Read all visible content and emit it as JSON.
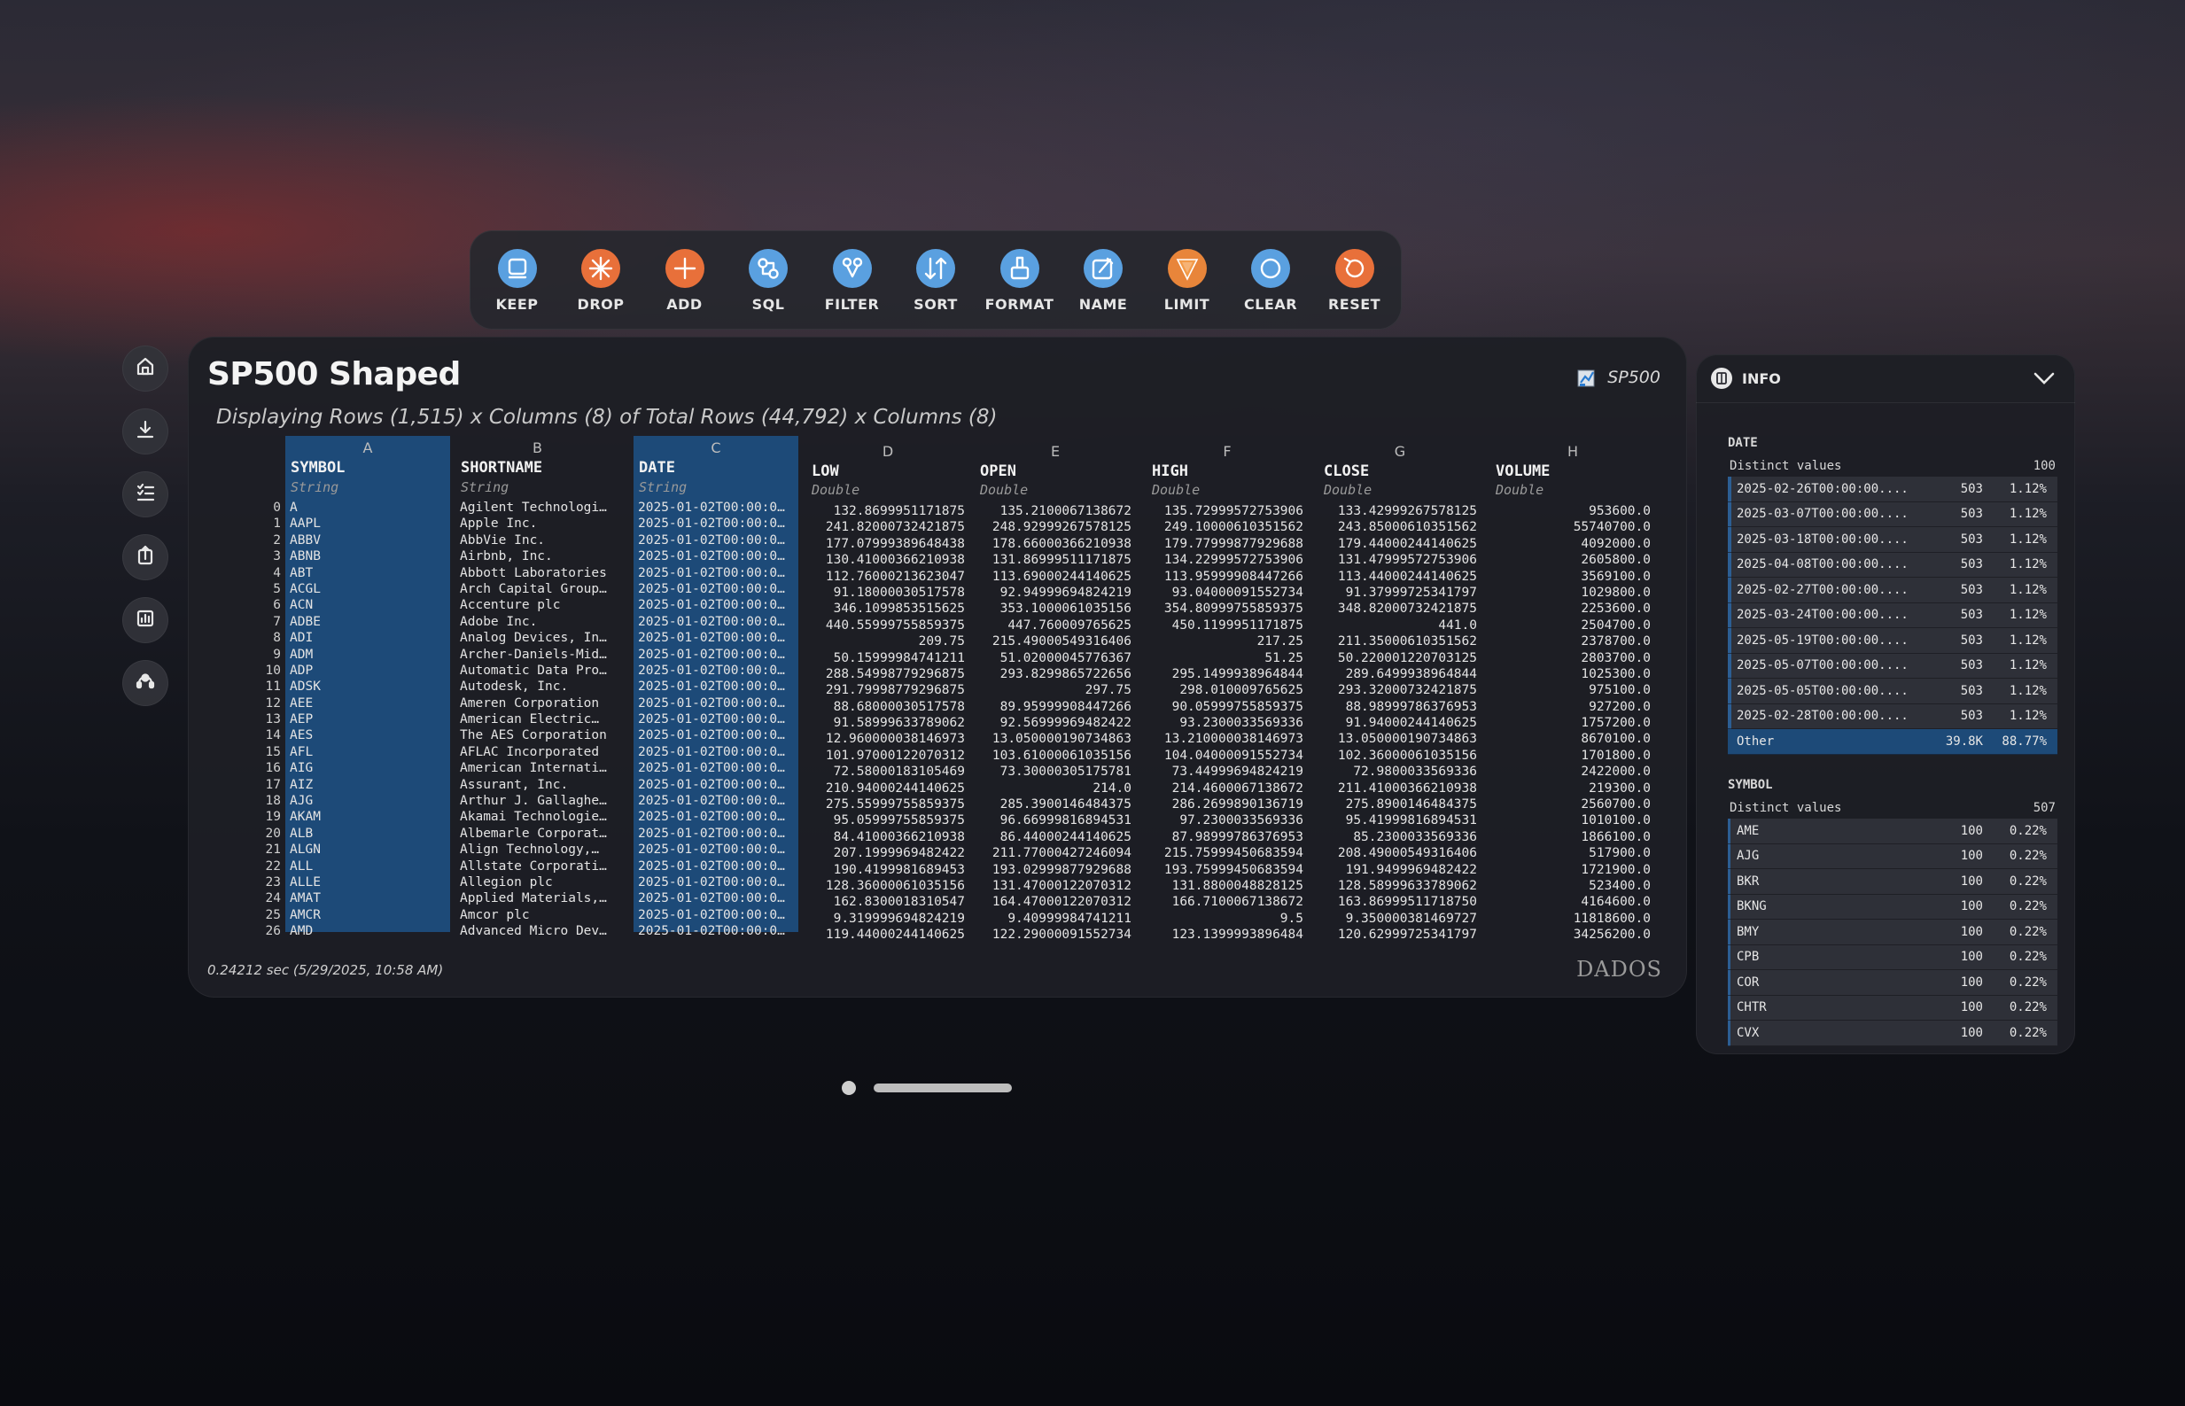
{
  "toolbar": {
    "items": [
      {
        "label": "KEEP",
        "icon": "keep-icon",
        "color": "#5aa0e0"
      },
      {
        "label": "DROP",
        "icon": "drop-icon",
        "color": "#e8703a"
      },
      {
        "label": "ADD",
        "icon": "add-icon",
        "color": "#e8703a"
      },
      {
        "label": "SQL",
        "icon": "sql-icon",
        "color": "#5aa0e0"
      },
      {
        "label": "FILTER",
        "icon": "filter-icon",
        "color": "#5aa0e0"
      },
      {
        "label": "SORT",
        "icon": "sort-icon",
        "color": "#5aa0e0"
      },
      {
        "label": "FORMAT",
        "icon": "format-icon",
        "color": "#5aa0e0"
      },
      {
        "label": "NAME",
        "icon": "name-icon",
        "color": "#5aa0e0"
      },
      {
        "label": "LIMIT",
        "icon": "limit-icon",
        "color": "#e8853a"
      },
      {
        "label": "CLEAR",
        "icon": "clear-icon",
        "color": "#5aa0e0"
      },
      {
        "label": "RESET",
        "icon": "reset-icon",
        "color": "#e8703a"
      }
    ]
  },
  "sidenav": [
    "home-icon",
    "download-icon",
    "list-icon",
    "upload-icon",
    "chart-icon",
    "support-icon"
  ],
  "table_panel": {
    "title": "SP500 Shaped",
    "subtitle": "Displaying Rows (1,515) x Columns (8) of Total Rows (44,792) x Columns (8)",
    "dataset": "SP500",
    "timing": "0.24212 sec  (5/29/2025, 10:58 AM)",
    "brand": "DADOS"
  },
  "columns": [
    {
      "letter": "A",
      "name": "SYMBOL",
      "type": "String",
      "selected": true,
      "numeric": false
    },
    {
      "letter": "B",
      "name": "SHORTNAME",
      "type": "String",
      "selected": false,
      "numeric": false
    },
    {
      "letter": "C",
      "name": "DATE",
      "type": "String",
      "selected": true,
      "numeric": false
    },
    {
      "letter": "D",
      "name": "LOW",
      "type": "Double",
      "selected": false,
      "numeric": true
    },
    {
      "letter": "E",
      "name": "OPEN",
      "type": "Double",
      "selected": false,
      "numeric": true
    },
    {
      "letter": "F",
      "name": "HIGH",
      "type": "Double",
      "selected": false,
      "numeric": true
    },
    {
      "letter": "G",
      "name": "CLOSE",
      "type": "Double",
      "selected": false,
      "numeric": true
    },
    {
      "letter": "H",
      "name": "VOLUME",
      "type": "Double",
      "selected": false,
      "numeric": true
    }
  ],
  "rows": [
    [
      "0",
      "A",
      "Agilent Technologi…",
      "2025-01-02T00:00:0…",
      "132.8699951171875",
      "135.2100067138672",
      "135.72999572753906",
      "133.42999267578125",
      "953600.0"
    ],
    [
      "1",
      "AAPL",
      "Apple Inc.",
      "2025-01-02T00:00:0…",
      "241.82000732421875",
      "248.92999267578125",
      "249.10000610351562",
      "243.85000610351562",
      "55740700.0"
    ],
    [
      "2",
      "ABBV",
      "AbbVie Inc.",
      "2025-01-02T00:00:0…",
      "177.07999389648438",
      "178.66000366210938",
      "179.77999877929688",
      "179.44000244140625",
      "4092000.0"
    ],
    [
      "3",
      "ABNB",
      "Airbnb, Inc.",
      "2025-01-02T00:00:0…",
      "130.41000366210938",
      "131.86999511171875",
      "134.22999572753906",
      "131.47999572753906",
      "2605800.0"
    ],
    [
      "4",
      "ABT",
      "Abbott Laboratories",
      "2025-01-02T00:00:0…",
      "112.76000213623047",
      "113.69000244140625",
      "113.95999908447266",
      "113.44000244140625",
      "3569100.0"
    ],
    [
      "5",
      "ACGL",
      "Arch Capital Group…",
      "2025-01-02T00:00:0…",
      "91.18000030517578",
      "92.94999694824219",
      "93.04000091552734",
      "91.37999725341797",
      "1029800.0"
    ],
    [
      "6",
      "ACN",
      "Accenture plc",
      "2025-01-02T00:00:0…",
      "346.1099853515625",
      "353.1000061035156",
      "354.80999755859375",
      "348.82000732421875",
      "2253600.0"
    ],
    [
      "7",
      "ADBE",
      "Adobe Inc.",
      "2025-01-02T00:00:0…",
      "440.55999755859375",
      "447.760009765625",
      "450.1199951171875",
      "441.0",
      "2504700.0"
    ],
    [
      "8",
      "ADI",
      "Analog Devices, In…",
      "2025-01-02T00:00:0…",
      "209.75",
      "215.49000549316406",
      "217.25",
      "211.35000610351562",
      "2378700.0"
    ],
    [
      "9",
      "ADM",
      "Archer-Daniels-Mid…",
      "2025-01-02T00:00:0…",
      "50.15999984741211",
      "51.02000045776367",
      "51.25",
      "50.220001220703125",
      "2803700.0"
    ],
    [
      "10",
      "ADP",
      "Automatic Data Pro…",
      "2025-01-02T00:00:0…",
      "288.54998779296875",
      "293.8299865722656",
      "295.1499938964844",
      "289.6499938964844",
      "1025300.0"
    ],
    [
      "11",
      "ADSK",
      "Autodesk, Inc.",
      "2025-01-02T00:00:0…",
      "291.79998779296875",
      "297.75",
      "298.010009765625",
      "293.32000732421875",
      "975100.0"
    ],
    [
      "12",
      "AEE",
      "Ameren Corporation",
      "2025-01-02T00:00:0…",
      "88.68000030517578",
      "89.95999908447266",
      "90.05999755859375",
      "88.98999786376953",
      "927200.0"
    ],
    [
      "13",
      "AEP",
      "American Electric…",
      "2025-01-02T00:00:0…",
      "91.58999633789062",
      "92.56999969482422",
      "93.2300033569336",
      "91.94000244140625",
      "1757200.0"
    ],
    [
      "14",
      "AES",
      "The AES Corporation",
      "2025-01-02T00:00:0…",
      "12.960000038146973",
      "13.050000190734863",
      "13.210000038146973",
      "13.050000190734863",
      "8670100.0"
    ],
    [
      "15",
      "AFL",
      "AFLAC Incorporated",
      "2025-01-02T00:00:0…",
      "101.97000122070312",
      "103.61000061035156",
      "104.04000091552734",
      "102.36000061035156",
      "1701800.0"
    ],
    [
      "16",
      "AIG",
      "American Internati…",
      "2025-01-02T00:00:0…",
      "72.58000183105469",
      "73.30000305175781",
      "73.44999694824219",
      "72.9800033569336",
      "2422000.0"
    ],
    [
      "17",
      "AIZ",
      "Assurant, Inc.",
      "2025-01-02T00:00:0…",
      "210.94000244140625",
      "214.0",
      "214.4600067138672",
      "211.41000366210938",
      "219300.0"
    ],
    [
      "18",
      "AJG",
      "Arthur J. Gallaghe…",
      "2025-01-02T00:00:0…",
      "275.55999755859375",
      "285.3900146484375",
      "286.2699890136719",
      "275.8900146484375",
      "2560700.0"
    ],
    [
      "19",
      "AKAM",
      "Akamai Technologie…",
      "2025-01-02T00:00:0…",
      "95.05999755859375",
      "96.66999816894531",
      "97.2300033569336",
      "95.41999816894531",
      "1010100.0"
    ],
    [
      "20",
      "ALB",
      "Albemarle Corporat…",
      "2025-01-02T00:00:0…",
      "84.41000366210938",
      "86.44000244140625",
      "87.98999786376953",
      "85.2300033569336",
      "1866100.0"
    ],
    [
      "21",
      "ALGN",
      "Align Technology,…",
      "2025-01-02T00:00:0…",
      "207.1999969482422",
      "211.77000427246094",
      "215.75999450683594",
      "208.49000549316406",
      "517900.0"
    ],
    [
      "22",
      "ALL",
      "Allstate Corporati…",
      "2025-01-02T00:00:0…",
      "190.4199981689453",
      "193.02999877929688",
      "193.75999450683594",
      "191.9499969482422",
      "1721900.0"
    ],
    [
      "23",
      "ALLE",
      "Allegion plc",
      "2025-01-02T00:00:0…",
      "128.36000061035156",
      "131.47000122070312",
      "131.8800048828125",
      "128.58999633789062",
      "523400.0"
    ],
    [
      "24",
      "AMAT",
      "Applied Materials,…",
      "2025-01-02T00:00:0…",
      "162.8300018310547",
      "164.47000122070312",
      "166.7100067138672",
      "163.86999511718750",
      "4164600.0"
    ],
    [
      "25",
      "AMCR",
      "Amcor plc",
      "2025-01-02T00:00:0…",
      "9.319999694824219",
      "9.40999984741211",
      "9.5",
      "9.350000381469727",
      "11818600.0"
    ],
    [
      "26",
      "AMD",
      "Advanced Micro Dev…",
      "2025-01-02T00:00:0…",
      "119.44000244140625",
      "122.29000091552734",
      "123.1399993896484",
      "120.62999725341797",
      "34256200.0"
    ]
  ],
  "info": {
    "title": "INFO",
    "sections": [
      {
        "name": "DATE",
        "distinct_label": "Distinct values",
        "distinct_count": "100",
        "rows": [
          {
            "value": "2025-02-26T00:00:00....",
            "count": "503",
            "pct": "1.12%",
            "frac": 0.0112
          },
          {
            "value": "2025-03-07T00:00:00....",
            "count": "503",
            "pct": "1.12%",
            "frac": 0.0112
          },
          {
            "value": "2025-03-18T00:00:00....",
            "count": "503",
            "pct": "1.12%",
            "frac": 0.0112
          },
          {
            "value": "2025-04-08T00:00:00....",
            "count": "503",
            "pct": "1.12%",
            "frac": 0.0112
          },
          {
            "value": "2025-02-27T00:00:00....",
            "count": "503",
            "pct": "1.12%",
            "frac": 0.0112
          },
          {
            "value": "2025-03-24T00:00:00....",
            "count": "503",
            "pct": "1.12%",
            "frac": 0.0112
          },
          {
            "value": "2025-05-19T00:00:00....",
            "count": "503",
            "pct": "1.12%",
            "frac": 0.0112
          },
          {
            "value": "2025-05-07T00:00:00....",
            "count": "503",
            "pct": "1.12%",
            "frac": 0.0112
          },
          {
            "value": "2025-05-05T00:00:00....",
            "count": "503",
            "pct": "1.12%",
            "frac": 0.0112
          },
          {
            "value": "2025-02-28T00:00:00....",
            "count": "503",
            "pct": "1.12%",
            "frac": 0.0112
          },
          {
            "value": "Other",
            "count": "39.8K",
            "pct": "88.77%",
            "frac": 0.8877,
            "other": true
          }
        ]
      },
      {
        "name": "SYMBOL",
        "distinct_label": "Distinct values",
        "distinct_count": "507",
        "rows": [
          {
            "value": "AME",
            "count": "100",
            "pct": "0.22%",
            "frac": 0.0022
          },
          {
            "value": "AJG",
            "count": "100",
            "pct": "0.22%",
            "frac": 0.0022
          },
          {
            "value": "BKR",
            "count": "100",
            "pct": "0.22%",
            "frac": 0.0022
          },
          {
            "value": "BKNG",
            "count": "100",
            "pct": "0.22%",
            "frac": 0.0022
          },
          {
            "value": "BMY",
            "count": "100",
            "pct": "0.22%",
            "frac": 0.0022
          },
          {
            "value": "CPB",
            "count": "100",
            "pct": "0.22%",
            "frac": 0.0022
          },
          {
            "value": "COR",
            "count": "100",
            "pct": "0.22%",
            "frac": 0.0022
          },
          {
            "value": "CHTR",
            "count": "100",
            "pct": "0.22%",
            "frac": 0.0022
          },
          {
            "value": "CVX",
            "count": "100",
            "pct": "0.22%",
            "frac": 0.0022
          }
        ]
      }
    ]
  }
}
